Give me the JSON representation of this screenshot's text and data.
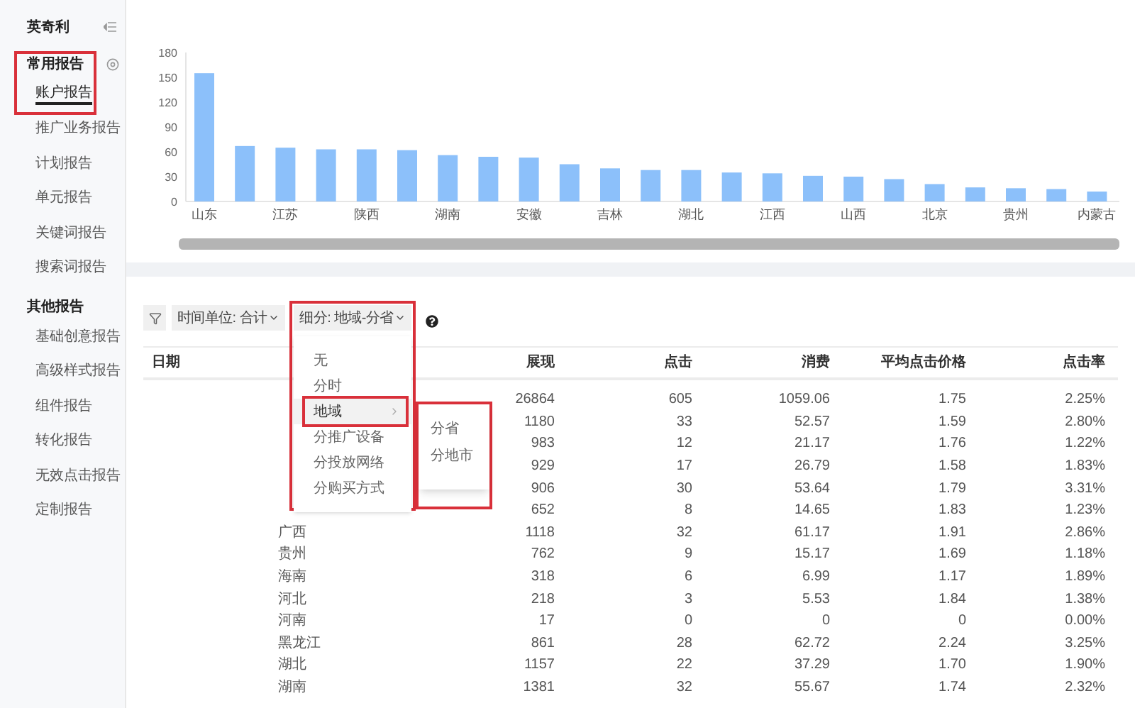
{
  "sidebar": {
    "title": "英奇利",
    "groups": [
      {
        "title": "常用报告",
        "items": [
          {
            "label": "账户报告",
            "selected": true
          },
          {
            "label": "推广业务报告",
            "selected": false
          },
          {
            "label": "计划报告",
            "selected": false
          },
          {
            "label": "单元报告",
            "selected": false
          },
          {
            "label": "关键词报告",
            "selected": false
          },
          {
            "label": "搜索词报告",
            "selected": false
          }
        ]
      },
      {
        "title": "其他报告",
        "items": [
          {
            "label": "基础创意报告",
            "selected": false
          },
          {
            "label": "高级样式报告",
            "selected": false
          },
          {
            "label": "组件报告",
            "selected": false
          },
          {
            "label": "转化报告",
            "selected": false
          },
          {
            "label": "无效点击报告",
            "selected": false
          },
          {
            "label": "定制报告",
            "selected": false
          }
        ]
      }
    ]
  },
  "chart": {
    "chart_data": {
      "type": "bar",
      "categories": [
        "山东",
        null,
        "江苏",
        null,
        "陕西",
        null,
        "湖南",
        null,
        "安徽",
        null,
        "吉林",
        null,
        "湖北",
        null,
        "江西",
        null,
        "山西",
        null,
        "北京",
        null,
        "贵州",
        null,
        "内蒙古"
      ],
      "series": [
        {
          "color": "#8cc0fa",
          "values": [
            155,
            67,
            65,
            63,
            63,
            62,
            56,
            54,
            53,
            45,
            40,
            38,
            38,
            35,
            34,
            31,
            30,
            27,
            21,
            17,
            16,
            15,
            12
          ]
        }
      ],
      "ylim": [
        0,
        180
      ],
      "yticks": [
        0,
        30,
        60,
        90,
        120,
        150,
        180
      ]
    }
  },
  "toolbar": {
    "time_unit": "时间单位: 合计",
    "breakdown": "细分: 地域-分省"
  },
  "table": {
    "columns": [
      "日期",
      "",
      "展现",
      "点击",
      "消费",
      "平均点击价格",
      "点击率"
    ],
    "rows": [
      {
        "cells": [
          "",
          "",
          "26864",
          "605",
          "1059.06",
          "1.75",
          "2.25%"
        ]
      },
      {
        "cells": [
          "",
          "",
          "1180",
          "33",
          "52.57",
          "1.59",
          "2.80%"
        ]
      },
      {
        "cells": [
          "",
          "",
          "983",
          "12",
          "21.17",
          "1.76",
          "1.22%"
        ]
      },
      {
        "cells": [
          "",
          "",
          "929",
          "17",
          "26.79",
          "1.58",
          "1.83%"
        ]
      },
      {
        "cells": [
          "",
          "",
          "906",
          "30",
          "53.64",
          "1.79",
          "3.31%"
        ]
      },
      {
        "cells": [
          "",
          "",
          "652",
          "8",
          "14.65",
          "1.83",
          "1.23%"
        ]
      },
      {
        "cells": [
          "",
          "广西",
          "1118",
          "32",
          "61.17",
          "1.91",
          "2.86%"
        ]
      },
      {
        "cells": [
          "",
          "贵州",
          "762",
          "9",
          "15.17",
          "1.69",
          "1.18%"
        ]
      },
      {
        "cells": [
          "",
          "海南",
          "318",
          "6",
          "6.99",
          "1.17",
          "1.89%"
        ]
      },
      {
        "cells": [
          "",
          "河北",
          "218",
          "3",
          "5.53",
          "1.84",
          "1.38%"
        ]
      },
      {
        "cells": [
          "",
          "河南",
          "17",
          "0",
          "0",
          "0",
          "0.00%"
        ]
      },
      {
        "cells": [
          "",
          "黑龙江",
          "861",
          "28",
          "62.72",
          "2.24",
          "3.25%"
        ]
      },
      {
        "cells": [
          "",
          "湖北",
          "1157",
          "22",
          "37.29",
          "1.70",
          "1.90%"
        ]
      },
      {
        "cells": [
          "",
          "湖南",
          "1381",
          "32",
          "55.67",
          "1.74",
          "2.32%"
        ]
      }
    ]
  },
  "dropdown": {
    "items": [
      {
        "label": "无",
        "selected": false,
        "kind": "plain"
      },
      {
        "label": "分时",
        "selected": false,
        "kind": "plain"
      },
      {
        "label": "地域",
        "selected": true,
        "kind": "submenu"
      },
      {
        "label": "分推广设备",
        "selected": false,
        "kind": "plain"
      },
      {
        "label": "分投放网络",
        "selected": false,
        "kind": "plain"
      },
      {
        "label": "分购买方式",
        "selected": false,
        "kind": "plain"
      }
    ],
    "submenu": [
      {
        "label": "分省"
      },
      {
        "label": "分地市"
      }
    ]
  }
}
